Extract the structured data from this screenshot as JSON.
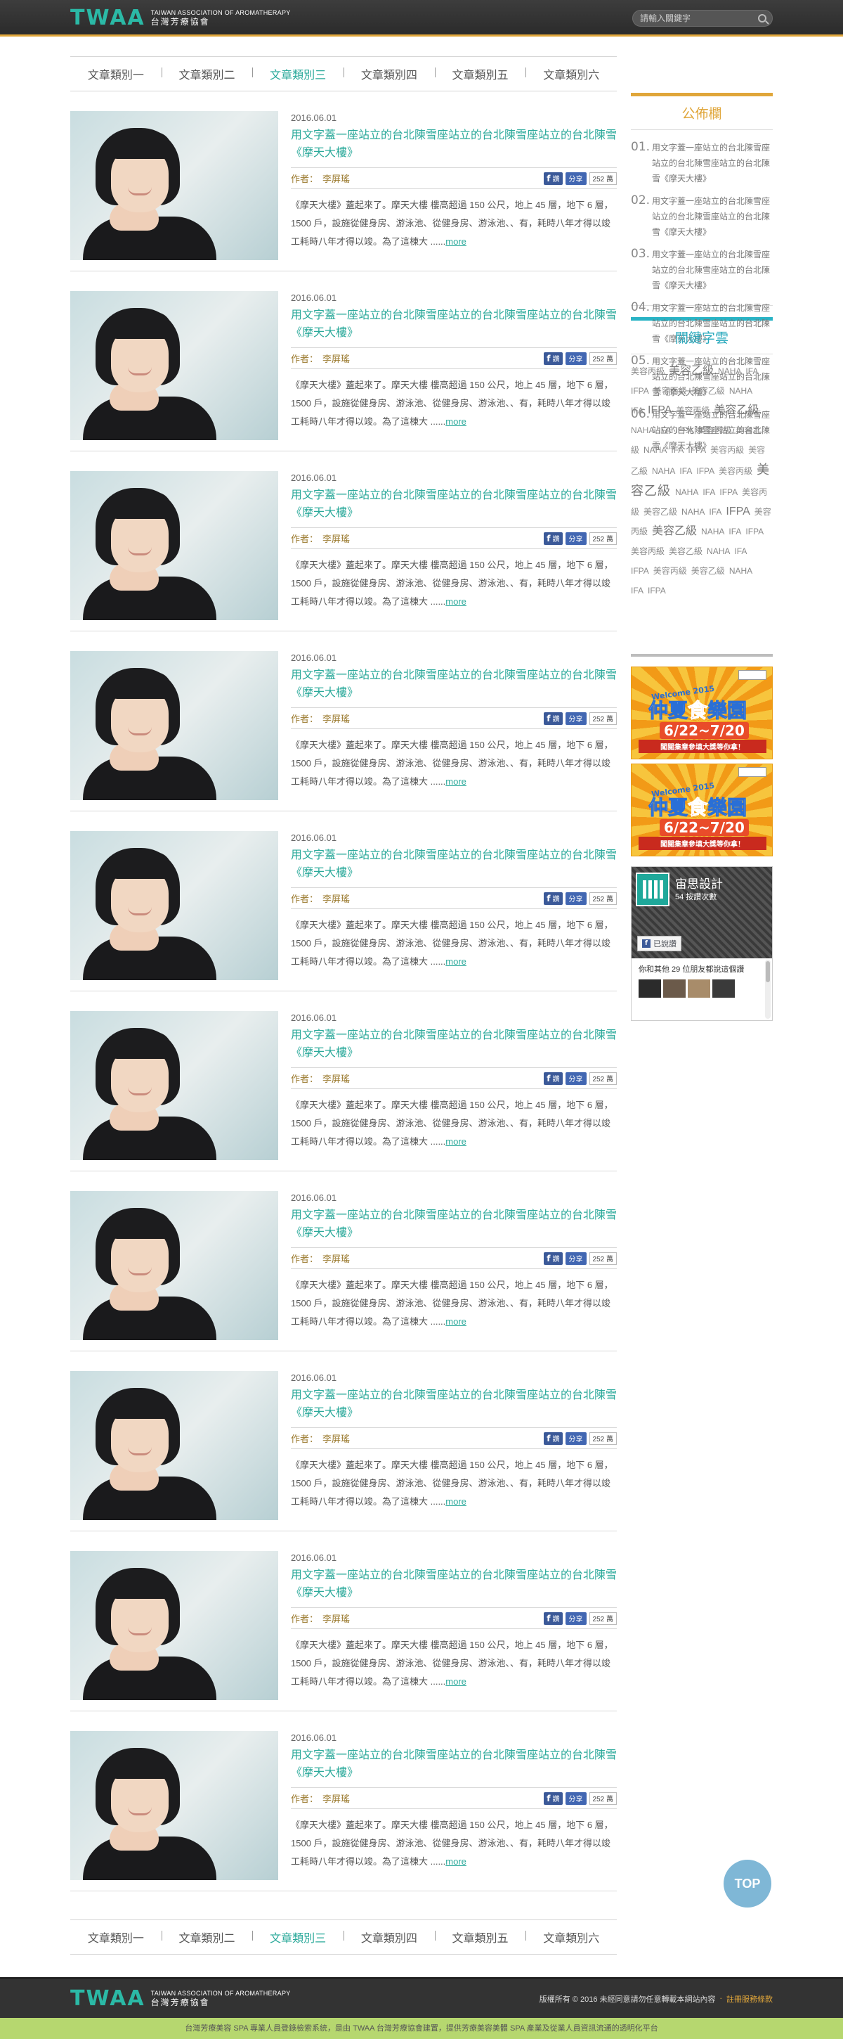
{
  "header": {
    "logo_mark": "TWAA",
    "logo_en": "TAIWAN ASSOCIATION OF AROMATHERAPY",
    "logo_zh": "台灣芳療協會",
    "search_placeholder": "請輸入關鍵字"
  },
  "categories": [
    "文章類別一",
    "文章類別二",
    "文章類別三",
    "文章類別四",
    "文章類別五",
    "文章類別六"
  ],
  "active_category": 2,
  "article": {
    "date": "2016.06.01",
    "title": "用文字蓋一座站立的台北陳雪座站立的台北陳雪座站立的台北陳雪《摩天大樓》",
    "author_label": "作者：",
    "author": "李屏瑤",
    "fb_label": "讚",
    "share_label": "分享",
    "share_count": "252 萬",
    "excerpt": "《摩天大樓》蓋起來了。摩天大樓 樓高超過 150 公尺，地上 45 層，地下 6 層，1500 戶，設施從健身房、游泳池、從健身房、游泳池、、有，耗時八年才得以竣工耗時八年才得以竣。為了這棟大 ......",
    "more": "more"
  },
  "sidebar": {
    "notice_title": "公佈欄",
    "notices": [
      {
        "num": "01.",
        "text": "用文字蓋一座站立的台北陳雪座站立的台北陳雪座站立的台北陳雪《摩天大樓》"
      },
      {
        "num": "02.",
        "text": "用文字蓋一座站立的台北陳雪座站立的台北陳雪座站立的台北陳雪《摩天大樓》"
      },
      {
        "num": "03.",
        "text": "用文字蓋一座站立的台北陳雪座站立的台北陳雪座站立的台北陳雪《摩天大樓》"
      },
      {
        "num": "04.",
        "text": "用文字蓋一座站立的台北陳雪座站立的台北陳雪座站立的台北陳雪《摩天大樓》"
      },
      {
        "num": "05.",
        "text": "用文字蓋一座站立的台北陳雪座站立的台北陳雪座站立的台北陳雪《摩天大樓》"
      },
      {
        "num": "06.",
        "text": "用文字蓋一座站立的台北陳雪座站立的台北陳雪座站立的台北陳雪《摩天大樓》"
      }
    ],
    "tags_title": "關鍵字雲",
    "tags": [
      [
        "美容丙級",
        1
      ],
      [
        "美容乙級",
        2
      ],
      [
        "NAHA",
        1
      ],
      [
        "IFA",
        1
      ],
      [
        "IFPA",
        1
      ],
      [
        "美容丙級",
        1
      ],
      [
        "美容乙級",
        1
      ],
      [
        "NAHA",
        1
      ],
      [
        "IFA",
        1
      ],
      [
        "IFPA",
        2
      ],
      [
        "美容丙級",
        1
      ],
      [
        "美容乙級",
        2
      ],
      [
        "NAHA",
        1
      ],
      [
        "IFA",
        1
      ],
      [
        "IFPA",
        1
      ],
      [
        "美容丙級",
        1
      ],
      [
        "美容乙級",
        1
      ],
      [
        "NAHA",
        1
      ],
      [
        "IFA",
        1
      ],
      [
        "IFPA",
        1
      ],
      [
        "美容丙級",
        1
      ],
      [
        "美容乙級",
        1
      ],
      [
        "NAHA",
        1
      ],
      [
        "IFA",
        1
      ],
      [
        "IFPA",
        1
      ],
      [
        "美容丙級",
        1
      ],
      [
        "美容乙級",
        3
      ],
      [
        "NAHA",
        1
      ],
      [
        "IFA",
        1
      ],
      [
        "IFPA",
        1
      ],
      [
        "美容丙級",
        1
      ],
      [
        "美容乙級",
        1
      ],
      [
        "NAHA",
        1
      ],
      [
        "IFA",
        1
      ],
      [
        "IFPA",
        2
      ],
      [
        "美容丙級",
        1
      ],
      [
        "美容乙級",
        2
      ],
      [
        "NAHA",
        1
      ],
      [
        "IFA",
        1
      ],
      [
        "IFPA",
        1
      ],
      [
        "美容丙級",
        1
      ],
      [
        "美容乙級",
        1
      ],
      [
        "NAHA",
        1
      ],
      [
        "IFA",
        1
      ],
      [
        "IFPA",
        1
      ],
      [
        "美容丙級",
        1
      ],
      [
        "美容乙級",
        1
      ],
      [
        "NAHA",
        1
      ],
      [
        "IFA",
        1
      ],
      [
        "IFPA",
        1
      ]
    ],
    "ad": {
      "welcome": "Welcome 2015",
      "title_a": "仲夏",
      "title_b": "食",
      "title_c": "樂園",
      "date": "6/22~7/20",
      "note": "闖關集章參填大獎等你拿！"
    },
    "fb": {
      "page_name": "宙思設計",
      "likes": "54 按讚次數",
      "liked": "已說讚",
      "friends": "你和其他 29 位朋友都說這個讚"
    }
  },
  "top_button": "TOP",
  "footer": {
    "logo_mark": "TWAA",
    "logo_en": "TAIWAN ASSOCIATION OF AROMATHERAPY",
    "logo_zh": "台灣芳療協會",
    "copyright": "版權所有 © 2016 未經同意請勿任意轉載本網站內容",
    "dot": "‧",
    "terms": "註冊服務條款",
    "bottom_text": "台灣芳療美容 SPA 專業人員登錄檢索系統，是由 TWAA 台灣芳療協會建置，提供芳療美容美體 SPA 產業及從業人員資訊流通的透明化平台"
  }
}
